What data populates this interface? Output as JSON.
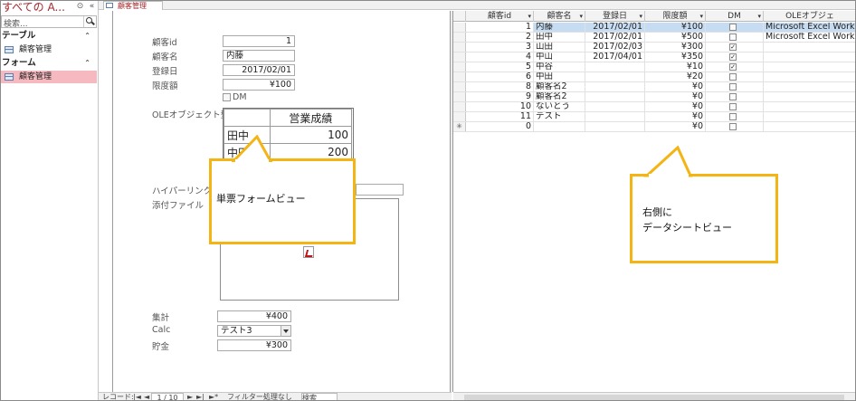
{
  "nav": {
    "title": "すべての A...",
    "search_placeholder": "検索...",
    "groups": [
      {
        "label": "テーブル",
        "items": [
          {
            "label": "顧客管理",
            "selected": false
          }
        ]
      },
      {
        "label": "フォーム",
        "items": [
          {
            "label": "顧客管理",
            "selected": true
          }
        ]
      }
    ],
    "collapse_glyph": "«",
    "options_glyph": "⊙",
    "group_toggle": "⌃"
  },
  "tab": {
    "label": "顧客管理"
  },
  "form": {
    "labels": {
      "id": "顧客id",
      "name": "顧客名",
      "date": "登録日",
      "limit": "限度額",
      "dm": "DM",
      "ole": "OLEオブジェクト型",
      "hyperlink": "ハイパーリンク",
      "attach": "添付ファイル",
      "total": "集計",
      "calc": "Calc",
      "savings": "貯金"
    },
    "values": {
      "id": "1",
      "name": "内藤",
      "date": "2017/02/01",
      "limit": "¥100",
      "total": "¥400",
      "calc": "テスト3",
      "savings": "¥300"
    },
    "ole_table": {
      "header": "営業成績",
      "rows": [
        [
          "田中",
          "100"
        ],
        [
          "中田",
          "200"
        ]
      ]
    }
  },
  "recnav": {
    "label": "レコード:",
    "first": "|◄",
    "prev": "◄",
    "position": "1 / 10",
    "next": "►",
    "last": "►|",
    "new": "►*",
    "filter": "フィルター処理なし",
    "search": "検索"
  },
  "datasheet": {
    "columns": [
      "顧客id",
      "顧客名",
      "登録日",
      "限度額",
      "DM",
      "OLEオブジェ"
    ],
    "rows": [
      {
        "id": "1",
        "name": "内藤",
        "date": "2017/02/01",
        "limit": "¥100",
        "dm": false,
        "ole": "Microsoft Excel Works",
        "selected": true
      },
      {
        "id": "2",
        "name": "田中",
        "date": "2017/02/01",
        "limit": "¥500",
        "dm": false,
        "ole": "Microsoft Excel Works",
        "selected": false
      },
      {
        "id": "3",
        "name": "山田",
        "date": "2017/02/03",
        "limit": "¥300",
        "dm": true,
        "ole": "",
        "selected": false
      },
      {
        "id": "4",
        "name": "中山",
        "date": "2017/04/01",
        "limit": "¥350",
        "dm": true,
        "ole": "",
        "selected": false
      },
      {
        "id": "5",
        "name": "中谷",
        "date": "",
        "limit": "¥10",
        "dm": true,
        "ole": "",
        "selected": false
      },
      {
        "id": "6",
        "name": "中田",
        "date": "",
        "limit": "¥20",
        "dm": false,
        "ole": "",
        "selected": false
      },
      {
        "id": "8",
        "name": "顧客名2",
        "date": "",
        "limit": "¥0",
        "dm": false,
        "ole": "",
        "selected": false
      },
      {
        "id": "9",
        "name": "顧客名2",
        "date": "",
        "limit": "¥0",
        "dm": false,
        "ole": "",
        "selected": false
      },
      {
        "id": "10",
        "name": "ないとう",
        "date": "",
        "limit": "¥0",
        "dm": false,
        "ole": "",
        "selected": false
      },
      {
        "id": "11",
        "name": "テスト",
        "date": "",
        "limit": "¥0",
        "dm": false,
        "ole": "",
        "selected": false
      },
      {
        "id": "0",
        "name": "",
        "date": "",
        "limit": "¥0",
        "dm": false,
        "ole": "",
        "selected": false,
        "new": true
      }
    ],
    "new_row_marker": "✳"
  },
  "callouts": {
    "left": "単票フォームビュー",
    "right": "右側に\nデータシートビュー"
  },
  "colors": {
    "accent": "#a4262c",
    "callout_border": "#f3b414",
    "selected_nav": "#f5b9bf",
    "selected_row": "#c6dcf3"
  }
}
